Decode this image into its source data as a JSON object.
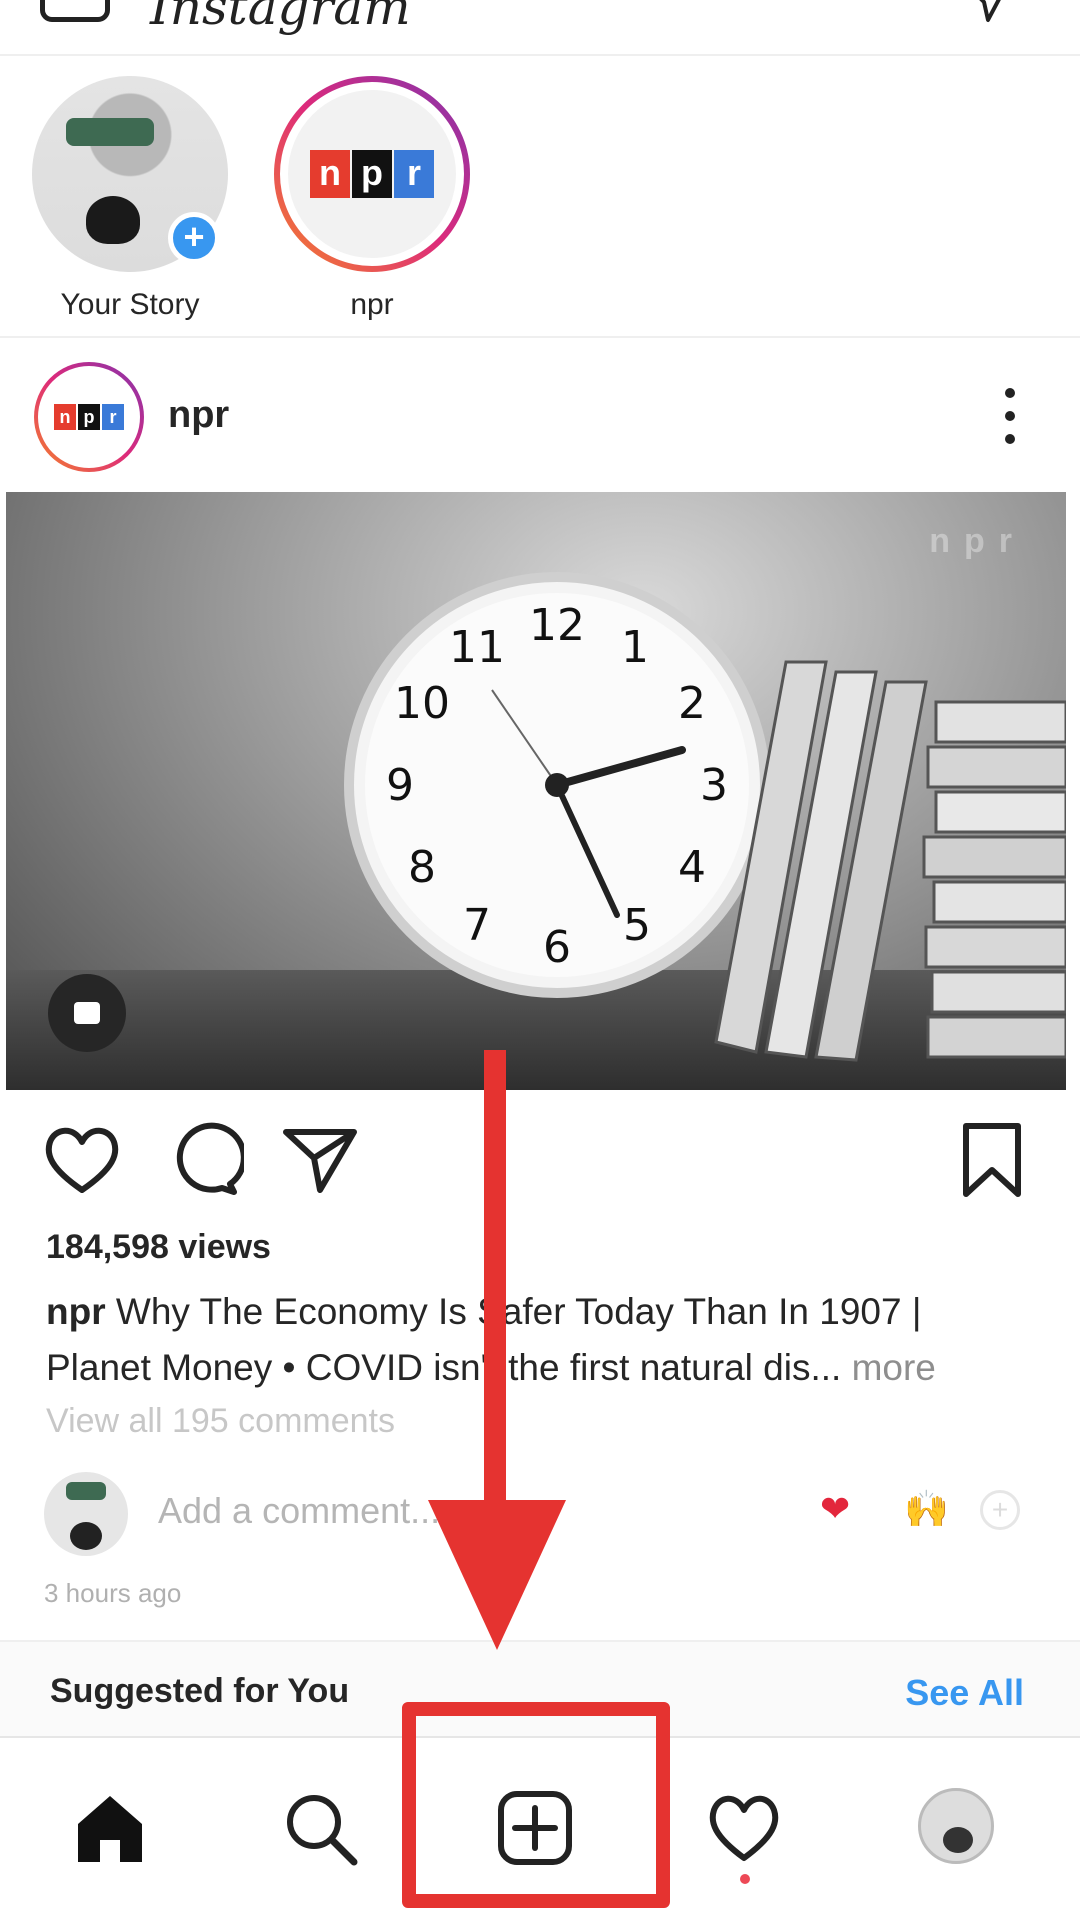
{
  "header": {
    "brand": "Instagram"
  },
  "stories": [
    {
      "label": "Your Story",
      "type": "own",
      "badge": "+"
    },
    {
      "label": "npr",
      "type": "account",
      "logo_letters": [
        "n",
        "p",
        "r"
      ]
    }
  ],
  "post": {
    "username": "npr",
    "logo_letters": [
      "n",
      "p",
      "r"
    ],
    "watermark": "npr",
    "views": "184,598 views",
    "caption_user": "npr",
    "caption_text": "Why The Economy Is Safer Today Than In 1907 | Planet Money • COVID isn't the first natural dis...",
    "caption_more": "more",
    "view_comments": "View all 195 comments",
    "comment_placeholder": "Add a comment...",
    "quick_reactions": [
      "❤",
      "🙌",
      "+"
    ],
    "timestamp": "3 hours ago"
  },
  "suggested": {
    "title": "Suggested for You",
    "see_all": "See All"
  },
  "bottom_nav": [
    {
      "name": "home",
      "icon": "home-icon",
      "active": true
    },
    {
      "name": "search",
      "icon": "search-icon"
    },
    {
      "name": "create",
      "icon": "plus-square-icon",
      "highlighted": true
    },
    {
      "name": "activity",
      "icon": "heart-icon",
      "notification": true
    },
    {
      "name": "profile",
      "icon": "avatar"
    }
  ],
  "colors": {
    "accent_blue": "#3897f0",
    "annotation_red": "#e53330",
    "npr_red": "#e53c2e",
    "npr_black": "#111111",
    "npr_blue": "#3a7ad8",
    "like_red": "#e3263c"
  }
}
